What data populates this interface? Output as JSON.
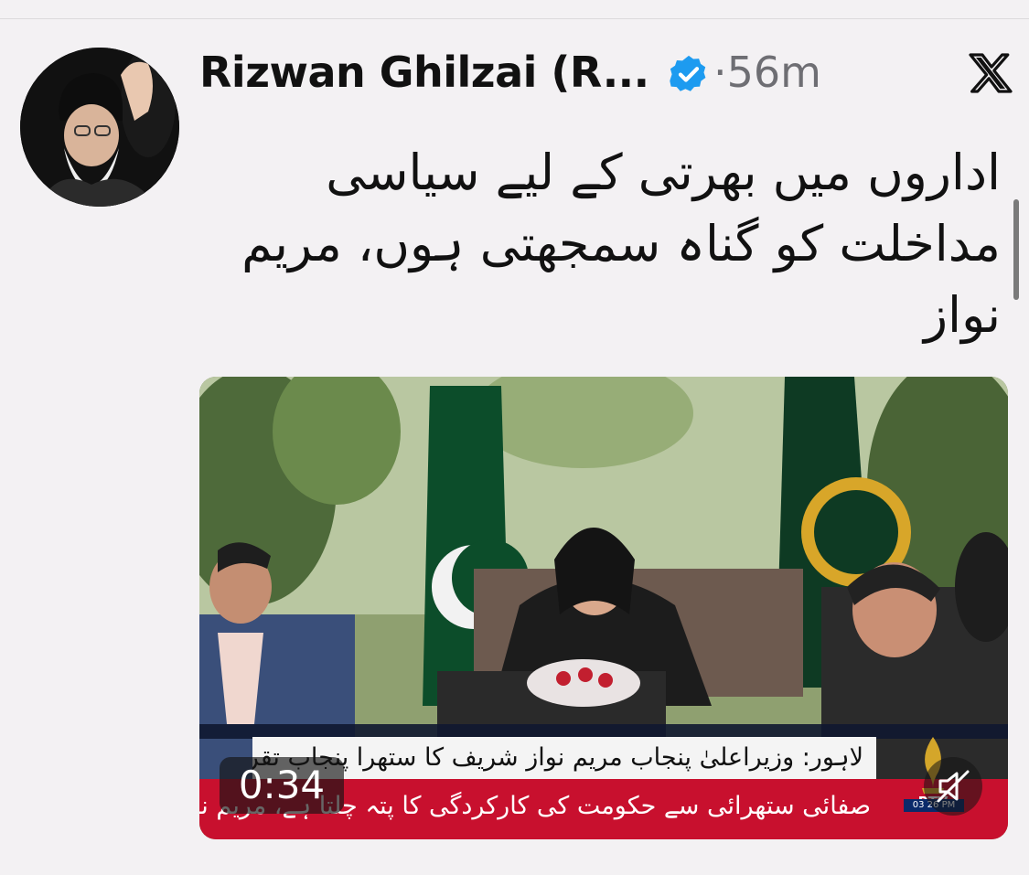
{
  "tweet": {
    "author": {
      "display_name": "Rizwan Ghilzai (R...",
      "verified": true
    },
    "time_separator": "·",
    "time_ago": "56m",
    "text": "اداروں میں بھرتی کے لیے سیاسی مداخلت کو گناہ سمجھتی ہوں، مریم نواز"
  },
  "media": {
    "type": "video",
    "duration": "0:34",
    "ticker_top": "لاہور: وزیراعلیٰ پنجاب مریم نواز شریف کا ستھرا پنجاب تقریب سے خطاب",
    "ticker_bottom": "صفائی ستھرائی سے حکومت کی کارکردگی کا پتہ چلتا ہے، مریم نواز",
    "channel_logo": "PTV",
    "channel_time": "03 26 PM"
  },
  "icons": {
    "verified": "verified-badge-icon",
    "platform": "x-logo-icon",
    "mute": "muted-speaker-icon"
  },
  "colors": {
    "verified_blue": "#1d9bf0",
    "ticker_red": "#c8102e",
    "background": "#f3f1f3"
  }
}
